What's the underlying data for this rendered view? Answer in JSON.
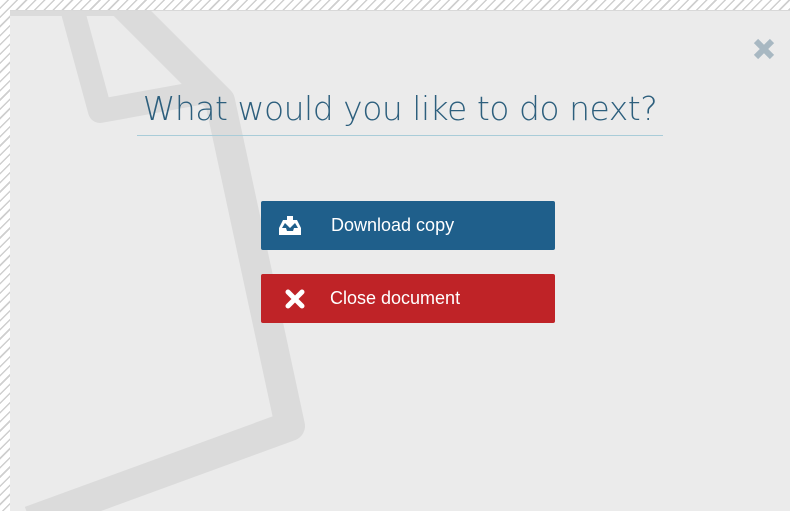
{
  "modal": {
    "title": "What would you like to do next?",
    "close_icon": "close-x-icon",
    "actions": {
      "download": {
        "label": "Download copy",
        "icon": "download-tray-icon",
        "color": "#1f5f8b"
      },
      "close": {
        "label": "Close document",
        "icon": "x-icon",
        "color": "#bf2327"
      }
    },
    "colors": {
      "background": "#ebebeb",
      "title": "#2d5f7d",
      "title_underline": "#a9ccd8",
      "close_icon": "#a8b8c2"
    }
  }
}
